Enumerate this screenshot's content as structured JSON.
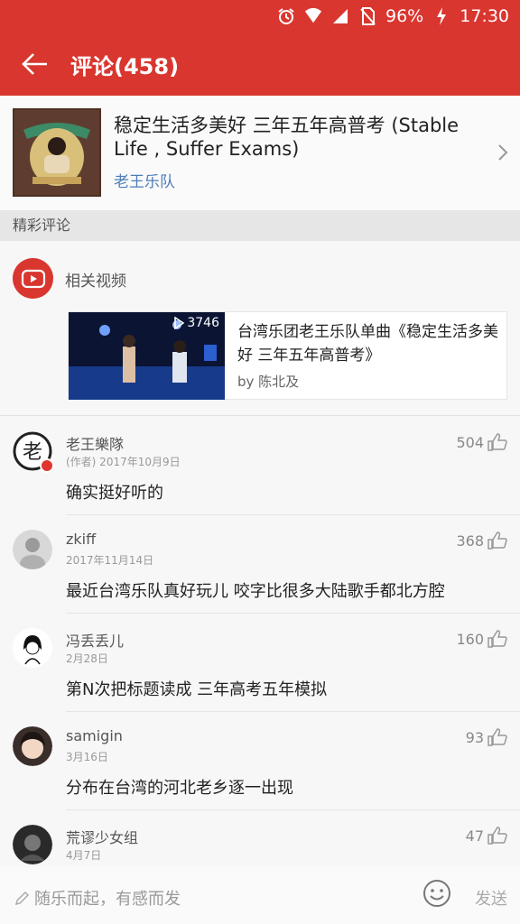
{
  "status_bar": {
    "battery": "96%",
    "time": "17:30"
  },
  "app_bar": {
    "title": "评论(458)"
  },
  "song": {
    "title": "稳定生活多美好 三年五年高普考 (Stable Life , Suffer Exams)",
    "artist": "老王乐队"
  },
  "section_header": "精彩评论",
  "related": {
    "label": "相关视频",
    "video": {
      "play_count": "3746",
      "title": "台湾乐团老王乐队单曲《稳定生活多美好 三年五年高普考》",
      "by": "by 陈北及"
    }
  },
  "comments": [
    {
      "name": "老王樂隊",
      "meta": "(作者) 2017年10月9日",
      "likes": "504",
      "text": "确实挺好听的"
    },
    {
      "name": "zkiff",
      "meta": "2017年11月14日",
      "likes": "368",
      "text": "最近台湾乐队真好玩儿 咬字比很多大陆歌手都北方腔"
    },
    {
      "name": "冯丢丢儿",
      "meta": "2月28日",
      "likes": "160",
      "text": "第N次把标题读成 三年高考五年模拟"
    },
    {
      "name": "samigin",
      "meta": "3月16日",
      "likes": "93",
      "text": "分布在台湾的河北老乡逐一出现"
    },
    {
      "name": "荒谬少女组",
      "meta": "4月7日",
      "likes": "47",
      "text": ""
    }
  ],
  "input_bar": {
    "placeholder": "随乐而起，有感而发",
    "send_label": "发送"
  },
  "colors": {
    "brand_red": "#d9362f",
    "link_blue": "#4d7eb8"
  }
}
